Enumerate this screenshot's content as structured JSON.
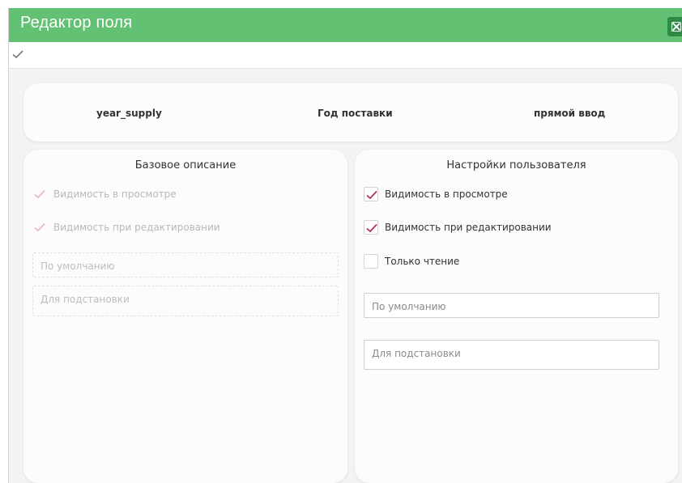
{
  "window": {
    "title": "Редактор поля",
    "accent_color": "#63c174",
    "close_icon": "close-window-icon"
  },
  "toolbar": {
    "save_icon": "checkmark-icon"
  },
  "summary": {
    "field_name": "year_supply",
    "field_title": "Год поставки",
    "input_type": "прямой ввод"
  },
  "base_description": {
    "title": "Базовое описание",
    "view_visibility": {
      "label": "Видимость в просмотре",
      "checked": true
    },
    "edit_visibility": {
      "label": "Видимость при редактировании",
      "checked": true
    },
    "default_placeholder": "По умолчанию",
    "substitution_placeholder": "Для подстановки"
  },
  "user_settings": {
    "title": "Настройки пользователя",
    "view_visibility": {
      "label": "Видимость в просмотре",
      "checked": true
    },
    "edit_visibility": {
      "label": "Видимость при редактировании",
      "checked": true
    },
    "read_only": {
      "label": "Только чтение",
      "checked": false
    },
    "default_placeholder": "По умолчанию",
    "substitution_placeholder": "Для подстановки",
    "check_color": "#b0315a"
  }
}
